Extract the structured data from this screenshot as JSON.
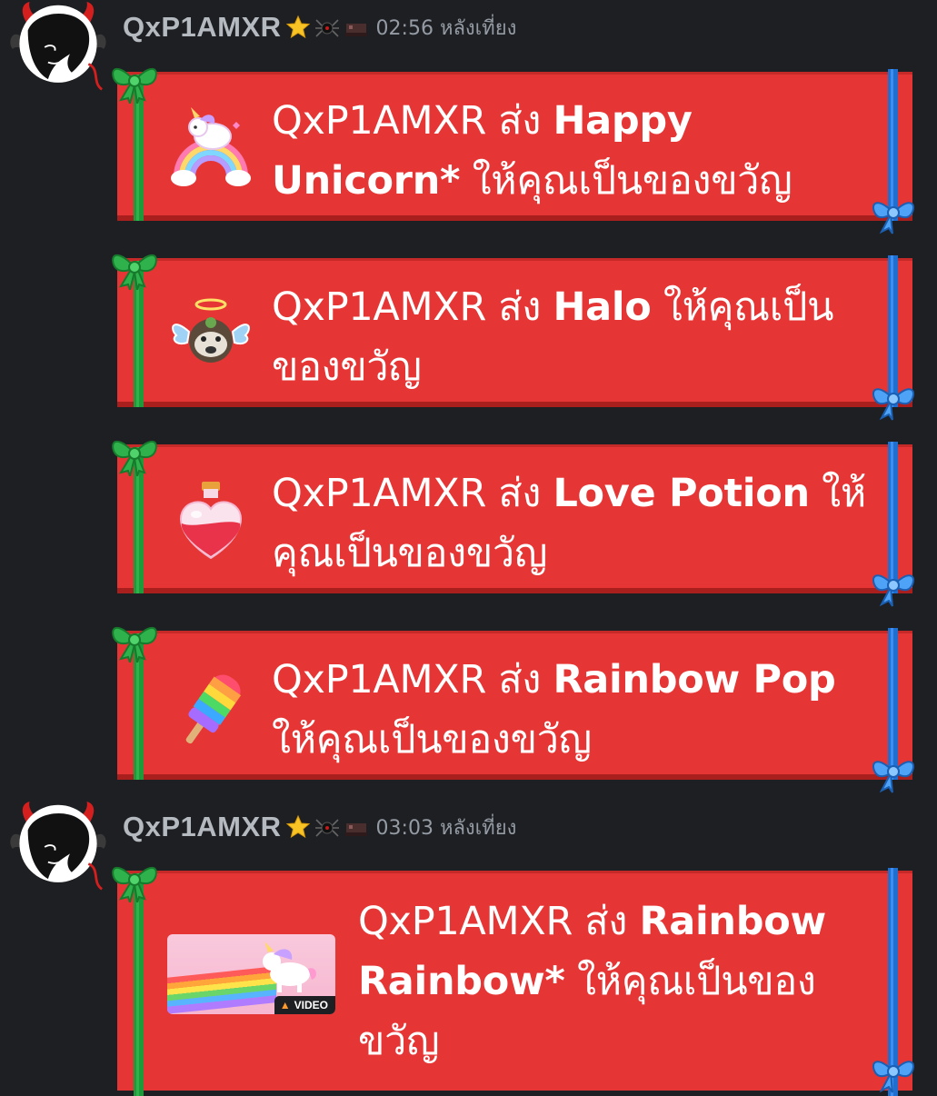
{
  "messages": [
    {
      "username": "QxP1AMXR",
      "timestamp": "02:56 หลังเที่ยง",
      "gifts": [
        {
          "sender": "QxP1AMXR",
          "verb": "ส่ง",
          "item": "Happy Unicorn*",
          "suffix": "ให้คุณเป็นของขวัญ",
          "icon": "unicorn-rainbow-icon"
        },
        {
          "sender": "QxP1AMXR",
          "verb": "ส่ง",
          "item": "Halo",
          "suffix": "ให้คุณเป็นของขวัญ",
          "icon": "halo-wings-icon"
        },
        {
          "sender": "QxP1AMXR",
          "verb": "ส่ง",
          "item": "Love Potion",
          "suffix": "ให้คุณเป็นของขวัญ",
          "icon": "love-potion-icon"
        },
        {
          "sender": "QxP1AMXR",
          "verb": "ส่ง",
          "item": "Rainbow Pop",
          "suffix": "ให้คุณเป็นของขวัญ",
          "icon": "rainbow-popsicle-icon"
        }
      ]
    },
    {
      "username": "QxP1AMXR",
      "timestamp": "03:03 หลังเที่ยง",
      "gifts": [
        {
          "sender": "QxP1AMXR",
          "verb": "ส่ง",
          "item": "Rainbow Rainbow*",
          "suffix": "ให้คุณเป็นของขวัญ",
          "icon": "video-thumbnail",
          "video_label": "VIDEO"
        }
      ]
    }
  ],
  "colors": {
    "background": "#1e1f22",
    "card": "#e53534",
    "ribbon_green": "#1f9a3a",
    "ribbon_blue": "#1f6fd1",
    "username": "#b5bac1",
    "timestamp": "#949ba4"
  }
}
